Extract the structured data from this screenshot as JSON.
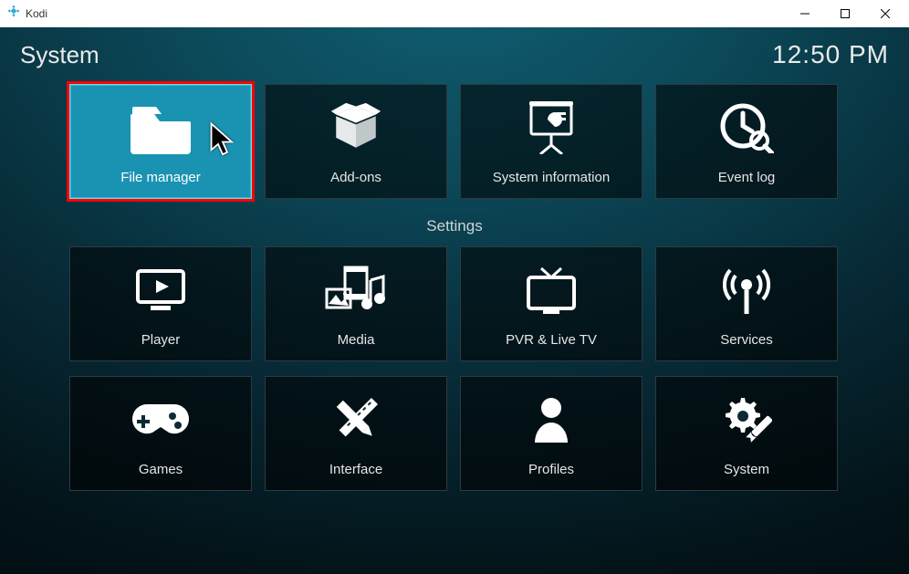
{
  "window": {
    "title": "Kodi"
  },
  "header": {
    "title": "System",
    "clock": "12:50 PM"
  },
  "tiles_top": [
    {
      "name": "file-manager",
      "label": "File manager"
    },
    {
      "name": "add-ons",
      "label": "Add-ons"
    },
    {
      "name": "system-info",
      "label": "System information"
    },
    {
      "name": "event-log",
      "label": "Event log"
    }
  ],
  "section_label": "Settings",
  "tiles_row2": [
    {
      "name": "player",
      "label": "Player"
    },
    {
      "name": "media",
      "label": "Media"
    },
    {
      "name": "pvr",
      "label": "PVR & Live TV"
    },
    {
      "name": "services",
      "label": "Services"
    }
  ],
  "tiles_row3": [
    {
      "name": "games",
      "label": "Games"
    },
    {
      "name": "interface",
      "label": "Interface"
    },
    {
      "name": "profiles",
      "label": "Profiles"
    },
    {
      "name": "system",
      "label": "System"
    }
  ],
  "selected_tile": "file-manager",
  "highlighted_tile": "file-manager"
}
